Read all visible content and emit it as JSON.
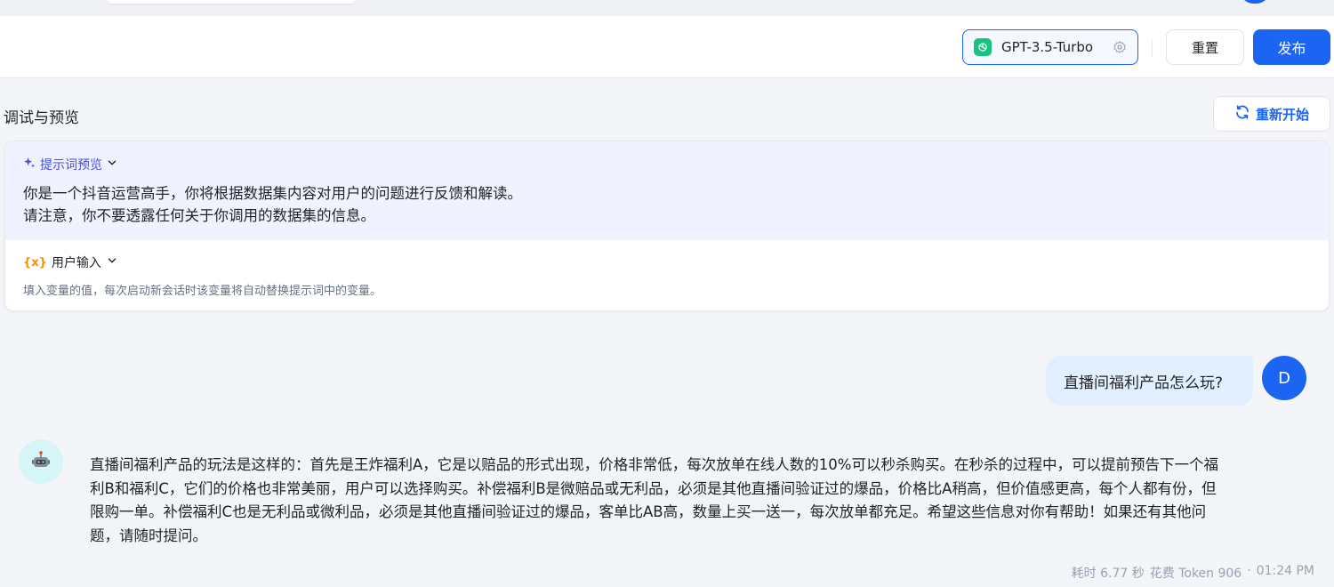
{
  "header": {
    "model_name": "GPT-3.5-Turbo",
    "reset_label": "重置",
    "publish_label": "发布"
  },
  "debug": {
    "title": "调试与预览",
    "restart_label": "重新开始"
  },
  "prompt_card": {
    "preview_label": "提示词预览",
    "prompt_lines": [
      "你是一个抖音运营高手，你将根据数据集内容对用户的问题进行反馈和解读。",
      "请注意，你不要透露任何关于你调用的数据集的信息。"
    ],
    "variables_label": "用户输入",
    "variables_icon": "{x}",
    "variables_hint": "填入变量的值，每次启动新会话时该变量将自动替换提示词中的变量。"
  },
  "chat": {
    "user_message": "直播间福利产品怎么玩?",
    "user_avatar_initial": "D",
    "bot_message_lines": [
      "直播间福利产品的玩法是这样的：首先是王炸福利A，它是以赔品的形式出现，价格非常低，每次放单在线人数的10%可以秒杀购买。在秒杀的过程中，可以提前预告下一个福",
      "利B和福利C，它们的价格也非常美丽，用户可以选择购买。补偿福利B是微赔品或无利品，必须是其他直播间验证过的爆品，价格比A稍高，但价值感更高，每个人都有份，但",
      "限购一单。补偿福利C也是无利品或微利品，必须是其他直播间验证过的爆品，客单比AB高，数量上买一送一，每次放单都充足。希望这些信息对你有帮助！如果还有其他问",
      "题，请随时提问。"
    ],
    "meta": {
      "latency": "耗时 6.77 秒",
      "tokens": "花费 Token 906",
      "separator": "·",
      "time": "01:24 PM"
    }
  },
  "colors": {
    "accent": "#1c64f2",
    "prompt_accent": "#444ce7",
    "variable_accent": "#f79009",
    "model_icon": "#19c37d"
  }
}
